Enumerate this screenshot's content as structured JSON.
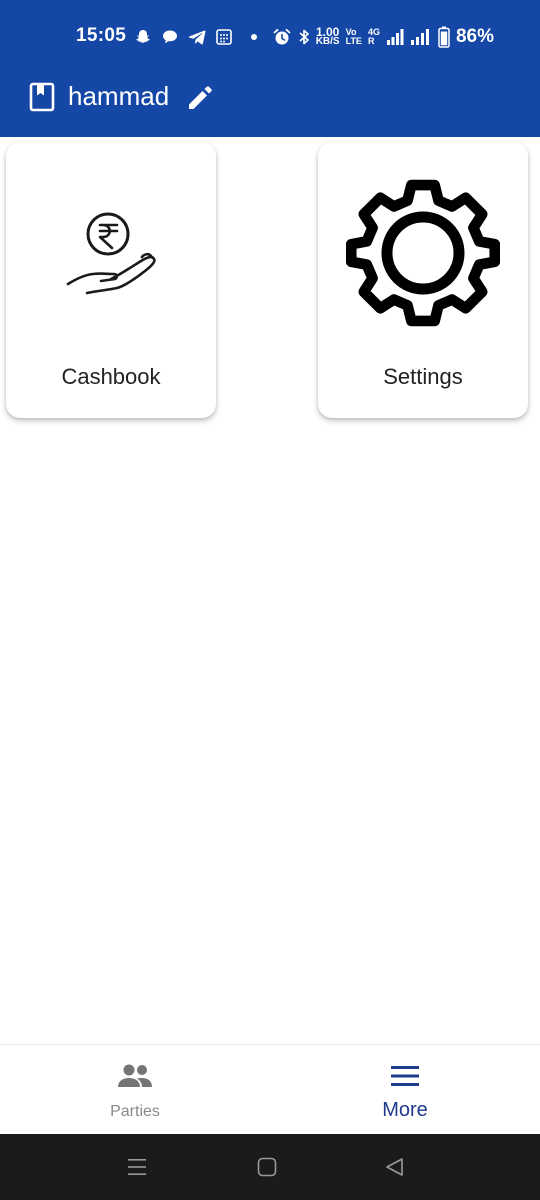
{
  "status_bar": {
    "time": "15:05",
    "net_speed_value": "1.00",
    "net_speed_unit": "KB/S",
    "volte_top": "Vo",
    "volte_bottom": "LTE",
    "network_type_top": "4G",
    "network_type_bottom": "R",
    "battery_percent": "86%",
    "icons_left": [
      "snapchat-icon",
      "chat-bubble-icon",
      "telegram-icon",
      "calendar-icon",
      "dot-icon"
    ],
    "icons_right": [
      "alarm-icon",
      "bluetooth-icon",
      "signal-icon",
      "signal-icon",
      "battery-icon"
    ]
  },
  "app_bar": {
    "account_name": "hammad",
    "book_icon": "book-icon",
    "edit_icon": "pencil-icon",
    "background_color": "#1447a6"
  },
  "cards": [
    {
      "label": "Cashbook",
      "icon": "rupee-hand-icon"
    },
    {
      "label": "Settings",
      "icon": "gear-icon"
    }
  ],
  "bottom_nav": {
    "items": [
      {
        "label": "Parties",
        "icon": "people-icon",
        "active": false
      },
      {
        "label": "More",
        "icon": "menu-icon",
        "active": true
      }
    ],
    "active_color": "#1f3a8f",
    "inactive_color": "#8a8a8a"
  },
  "system_nav": {
    "buttons": [
      "menu-icon",
      "home-icon",
      "back-icon"
    ]
  }
}
